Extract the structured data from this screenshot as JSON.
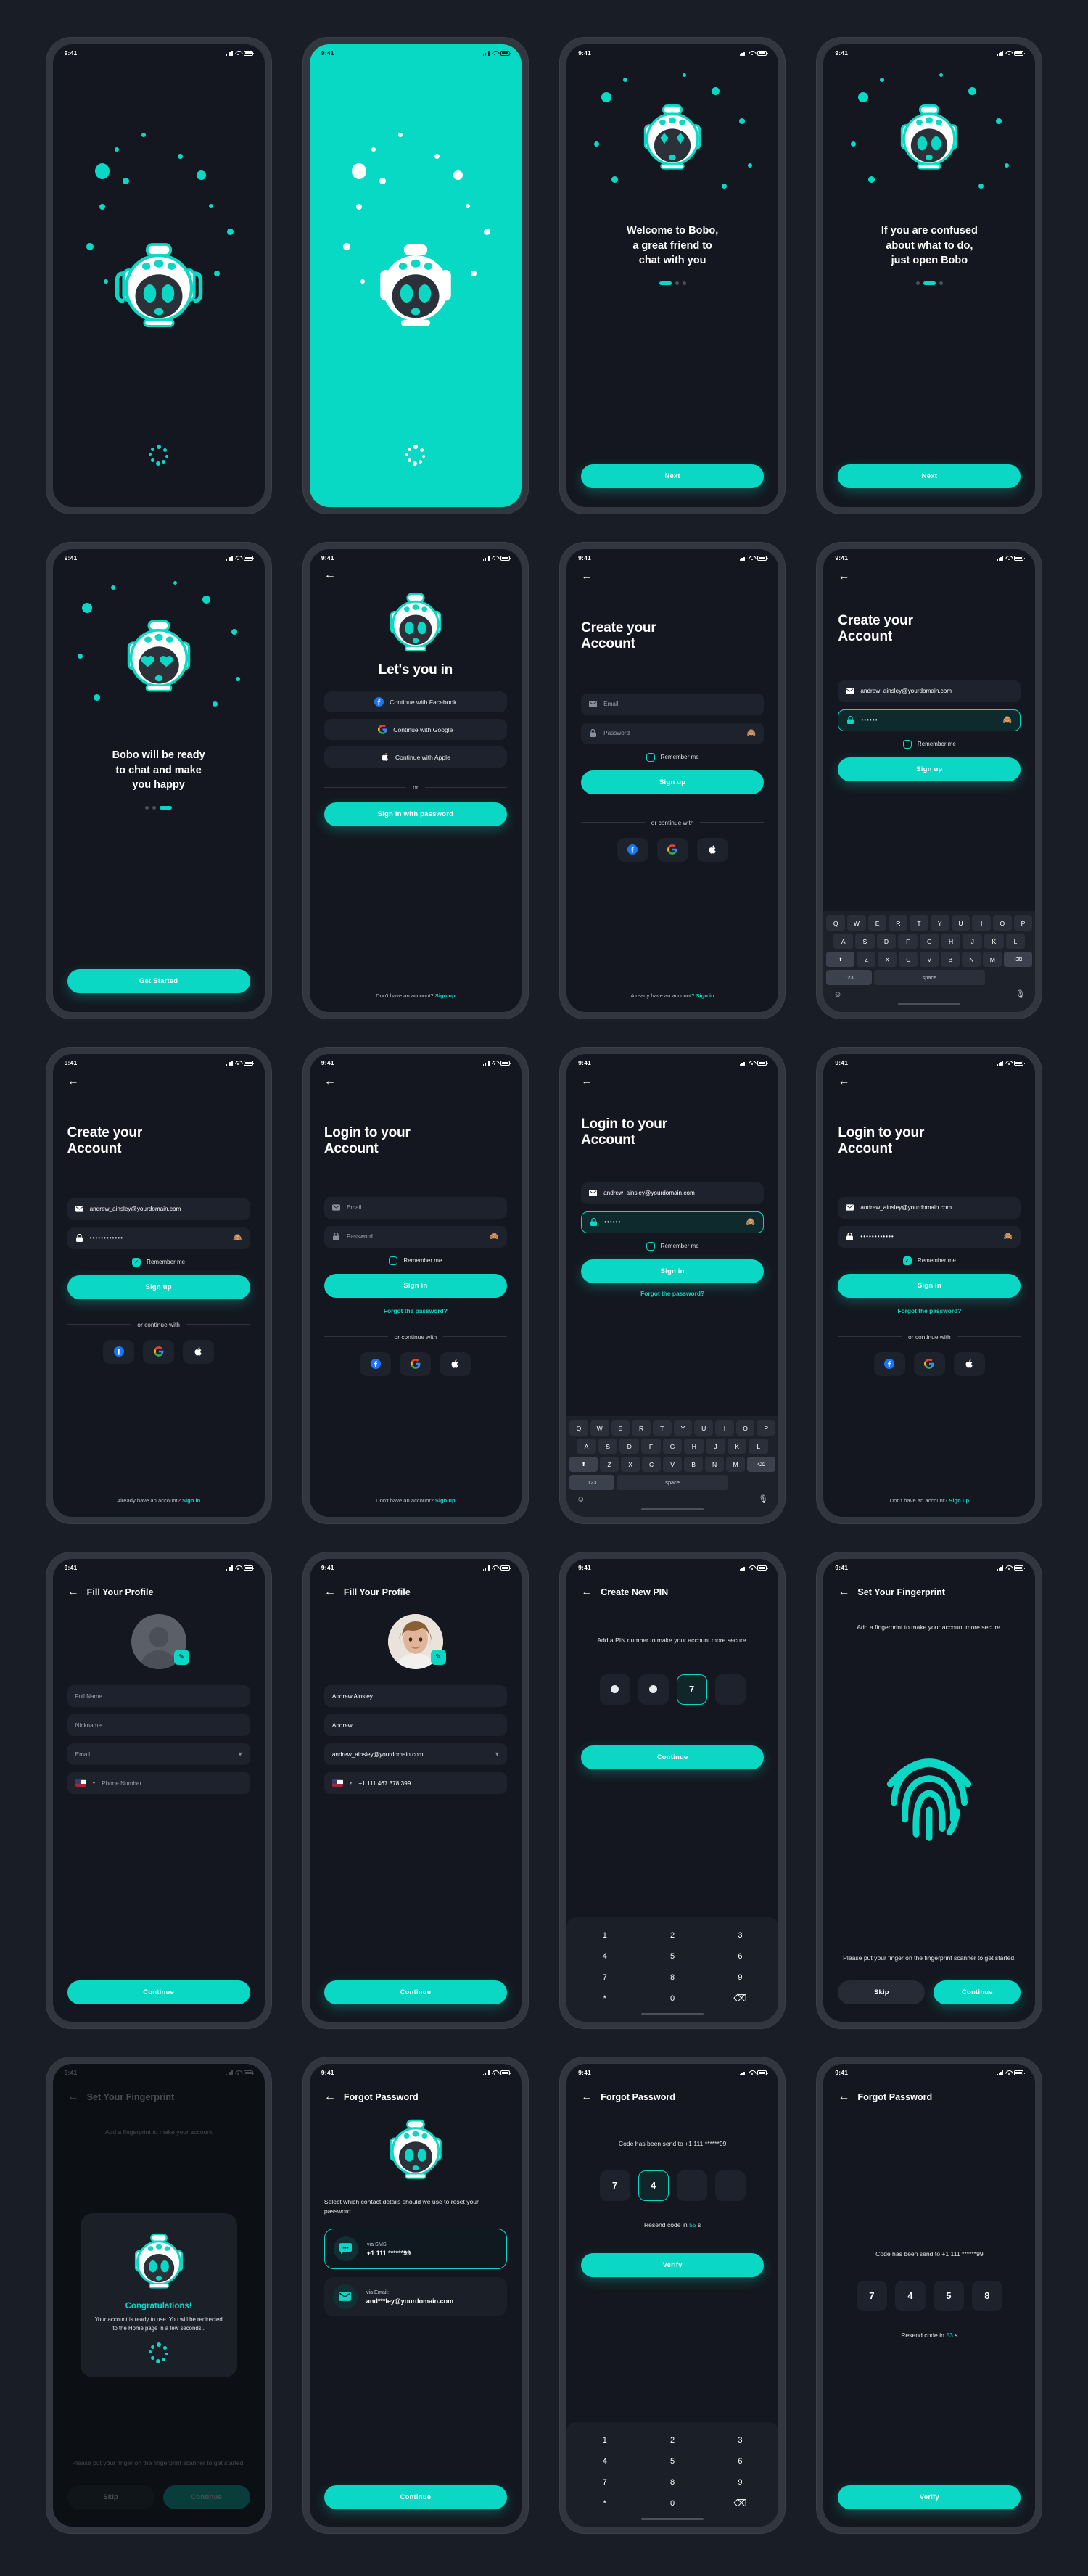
{
  "status_bar": {
    "time": "9:41"
  },
  "screens": [
    {
      "id": "splash-dark",
      "name": "Splash Dark",
      "loading": true
    },
    {
      "id": "splash-teal",
      "name": "Splash Teal",
      "loading": true
    },
    {
      "id": "onboarding-1",
      "name": "Onboarding 1",
      "headline": "Welcome to Bobo,\na great friend to\nchat with you",
      "button": "Next",
      "active_dot": 0
    },
    {
      "id": "onboarding-2",
      "name": "Onboarding 2",
      "headline": "If you are confused\nabout what to do,\njust open Bobo",
      "button": "Next",
      "active_dot": 1
    },
    {
      "id": "onboarding-3",
      "name": "Onboarding 3",
      "headline": "Bobo will be ready\nto chat and make\nyou happy",
      "button": "Get Started",
      "active_dot": 2
    },
    {
      "id": "lets-you-in",
      "name": "Let's you in",
      "title": "Let's you in",
      "social_buttons": [
        {
          "label": "Continue with Facebook",
          "icon": "facebook-icon"
        },
        {
          "label": "Continue with Google",
          "icon": "google-icon"
        },
        {
          "label": "Continue with Apple",
          "icon": "apple-icon"
        }
      ],
      "divider": "or",
      "primary_button": "Sign in with password",
      "footer_text": "Don't have an account?",
      "footer_link": "Sign up"
    },
    {
      "id": "signup-empty",
      "name": "Create your Account (empty)",
      "title": "Create your\nAccount",
      "email_placeholder": "Email",
      "password_placeholder": "Password",
      "remember_label": "Remember me",
      "remember_checked": false,
      "primary_button": "Sign up",
      "divider": "or continue with",
      "footer_text": "Already have an account?",
      "footer_link": "Sign in"
    },
    {
      "id": "signup-keyboard",
      "name": "Create your Account (typing)",
      "title": "Create your\nAccount",
      "email_value": "andrew_ainsley@yourdomain.com",
      "password_value": "••••••",
      "remember_label": "Remember me",
      "remember_checked": false,
      "primary_button": "Sign up"
    },
    {
      "id": "signup-filled",
      "name": "Create your Account (filled)",
      "title": "Create your\nAccount",
      "email_value": "andrew_ainsley@yourdomain.com",
      "password_value": "••••••••••••",
      "remember_label": "Remember me",
      "remember_checked": true,
      "primary_button": "Sign up",
      "divider": "or continue with",
      "footer_text": "Already have an account?",
      "footer_link": "Sign in"
    },
    {
      "id": "login-empty",
      "name": "Login to your Account (empty)",
      "title": "Login to your\nAccount",
      "email_placeholder": "Email",
      "password_placeholder": "Password",
      "remember_label": "Remember me",
      "remember_checked": false,
      "primary_button": "Sign in",
      "forgot_link": "Forgot the password?",
      "divider": "or continue with",
      "footer_text": "Don't have an account?",
      "footer_link": "Sign up"
    },
    {
      "id": "login-keyboard",
      "name": "Login to your Account (typing)",
      "title": "Login to your\nAccount",
      "email_value": "andrew_ainsley@yourdomain.com",
      "password_value": "••••••",
      "remember_label": "Remember me",
      "remember_checked": false,
      "primary_button": "Sign in",
      "forgot_link": "Forgot the password?"
    },
    {
      "id": "login-filled",
      "name": "Login to your Account (filled)",
      "title": "Login to your\nAccount",
      "email_value": "andrew_ainsley@yourdomain.com",
      "password_value": "••••••••••••",
      "remember_label": "Remember me",
      "remember_checked": true,
      "primary_button": "Sign in",
      "forgot_link": "Forgot the password?",
      "divider": "or continue with",
      "footer_text": "Don't have an account?",
      "footer_link": "Sign up"
    },
    {
      "id": "profile-empty",
      "name": "Fill Your Profile (empty)",
      "appbar_title": "Fill Your Profile",
      "fields": [
        {
          "placeholder": "Full Name",
          "value": ""
        },
        {
          "placeholder": "Nickname",
          "value": ""
        },
        {
          "placeholder": "Email",
          "value": "",
          "tail": "chevron-down-icon"
        },
        {
          "placeholder": "Phone Number",
          "value": "",
          "flag": "us-flag-icon"
        }
      ],
      "button": "Continue"
    },
    {
      "id": "profile-filled",
      "name": "Fill Your Profile (filled)",
      "appbar_title": "Fill Your Profile",
      "fields": [
        {
          "placeholder": "Full Name",
          "value": "Andrew Ainsley"
        },
        {
          "placeholder": "Nickname",
          "value": "Andrew"
        },
        {
          "placeholder": "Email",
          "value": "andrew_ainsley@yourdomain.com",
          "tail": "chevron-down-icon"
        },
        {
          "placeholder": "Phone Number",
          "value": "+1 111 467 378 399",
          "flag": "us-flag-icon"
        }
      ],
      "button": "Continue"
    },
    {
      "id": "create-pin",
      "name": "Create New PIN",
      "appbar_title": "Create New PIN",
      "description": "Add a PIN number to make your account more secure.",
      "pins": [
        "•",
        "•",
        "7",
        ""
      ],
      "selected_pin_index": 2,
      "button": "Continue",
      "keypad": [
        "1",
        "2",
        "3",
        "4",
        "5",
        "6",
        "7",
        "8",
        "9",
        "*",
        "0",
        "⌫"
      ]
    },
    {
      "id": "fingerprint",
      "name": "Set Your Fingerprint",
      "appbar_title": "Set Your Fingerprint",
      "description": "Add a fingerprint to make your account more secure.",
      "hint": "Please put your finger on the fingerprint scanner to get started.",
      "secondary_button": "Skip",
      "primary_button": "Continue"
    },
    {
      "id": "fingerprint-success",
      "name": "Set Your Fingerprint (success)",
      "appbar_title": "Set Your Fingerprint",
      "description": "Add a fingerprint to make your account",
      "hint": "Please put your finger on the fingerprint scanner to get started.",
      "secondary_button": "Skip",
      "primary_button": "Continue",
      "modal_title": "Congratulations!",
      "modal_text": "Your account is ready to use. You will be redirected to the Home page in a few seconds.."
    },
    {
      "id": "forgot-password",
      "name": "Forgot Password",
      "appbar_title": "Forgot Password",
      "description": "Select which contact details should we use to reset your password",
      "options": [
        {
          "label": "via SMS:",
          "value": "+1 111 ******99",
          "icon": "chat-bubble-icon",
          "selected": true
        },
        {
          "label": "via Email:",
          "value": "and***ley@yourdomain.com",
          "icon": "envelope-icon",
          "selected": false
        }
      ],
      "button": "Continue"
    },
    {
      "id": "otp-keypad",
      "name": "Forgot Password OTP (keypad)",
      "appbar_title": "Forgot Password",
      "sent_text": "Code has been send to +1 111 ******99",
      "code": [
        "7",
        "4",
        "",
        ""
      ],
      "selected_index": 1,
      "resend_prefix": "Resend code in",
      "resend_seconds": "55",
      "resend_suffix": "s",
      "button": "Verify",
      "keypad": [
        "1",
        "2",
        "3",
        "4",
        "5",
        "6",
        "7",
        "8",
        "9",
        "*",
        "0",
        "⌫"
      ]
    },
    {
      "id": "otp-complete",
      "name": "Forgot Password OTP (complete)",
      "appbar_title": "Forgot Password",
      "sent_text": "Code has been send to +1 111 ******99",
      "code": [
        "7",
        "4",
        "5",
        "8"
      ],
      "resend_prefix": "Resend code in",
      "resend_seconds": "53",
      "resend_suffix": "s",
      "button": "Verify"
    }
  ],
  "keyboard": {
    "row1": [
      "Q",
      "W",
      "E",
      "R",
      "T",
      "Y",
      "U",
      "I",
      "O",
      "P"
    ],
    "row2": [
      "A",
      "S",
      "D",
      "F",
      "G",
      "H",
      "J",
      "K",
      "L"
    ],
    "row3": [
      "⬆",
      "Z",
      "X",
      "C",
      "V",
      "B",
      "N",
      "M",
      "⌫"
    ],
    "num_key": "123",
    "space_key": "space",
    "emoji_icon": "emoji-icon",
    "mic_icon": "microphone-icon"
  },
  "colors": {
    "accent": "#0bd8c4",
    "page_bg": "#191d26",
    "screen_bg": "#14171f",
    "frame": "#32363f",
    "field_bg": "#1e222c"
  }
}
